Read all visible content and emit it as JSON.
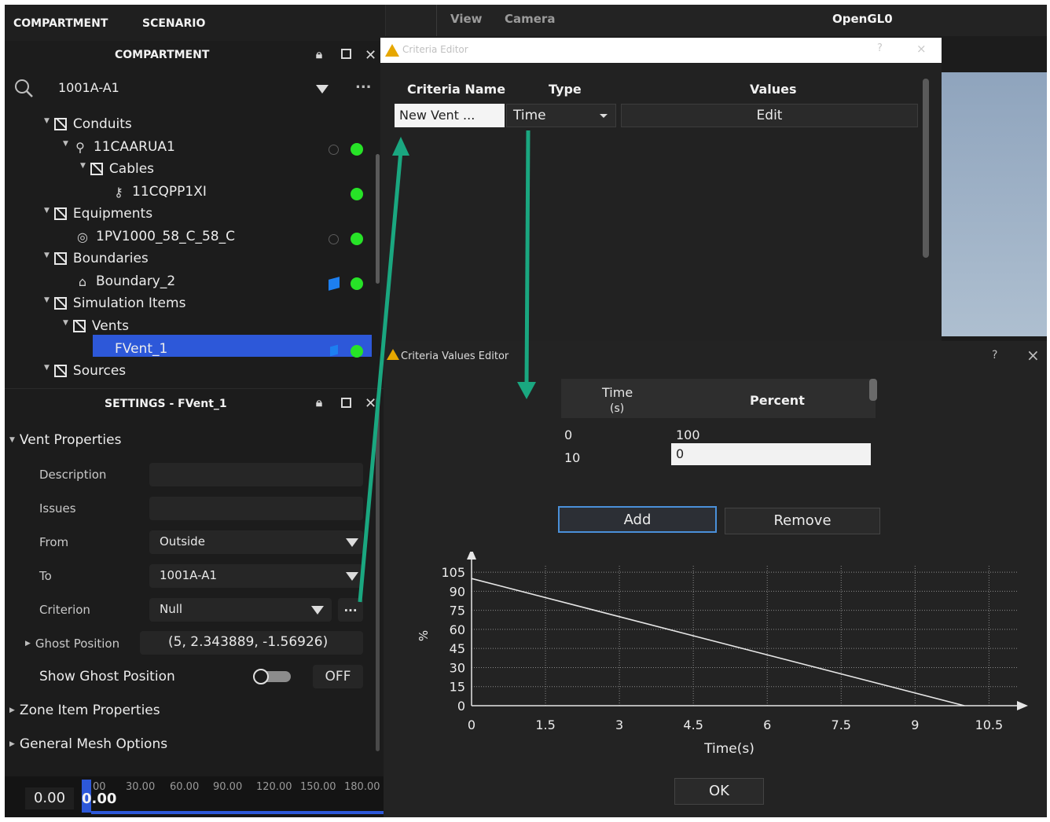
{
  "menu": {
    "compartment": "COMPARTMENT",
    "scenario": "SCENARIO"
  },
  "viewbar": {
    "view": "View",
    "camera": "Camera",
    "renderer": "OpenGL0"
  },
  "compartment_panel": {
    "title": "COMPARTMENT",
    "search_value": "1001A-A1",
    "more": "...",
    "tree": {
      "conduits": "Conduits",
      "conduit_item": "11CAARUA1",
      "cables": "Cables",
      "cable_item": "11CQPP1XI",
      "equipments": "Equipments",
      "equipment_item": "1PV1000_58_C_58_C",
      "boundaries": "Boundaries",
      "boundary_item": "Boundary_2",
      "simulation_items": "Simulation Items",
      "vents": "Vents",
      "vent_item": "FVent_1",
      "sources": "Sources"
    }
  },
  "settings_panel": {
    "title": "SETTINGS - FVent_1",
    "vent_properties": "Vent Properties",
    "description_label": "Description",
    "issues_label": "Issues",
    "from_label": "From",
    "from_value": "Outside",
    "to_label": "To",
    "to_value": "1001A-A1",
    "criterion_label": "Criterion",
    "criterion_value": "Null",
    "criterion_more": "...",
    "ghost_position_label": "Ghost Position",
    "ghost_position_value": "(5, 2.343889, -1.56926)",
    "show_ghost_label": "Show Ghost Position",
    "show_ghost_value": "OFF",
    "zone_item_properties": "Zone Item Properties",
    "general_mesh_options": "General Mesh Options"
  },
  "timeline": {
    "current": "0.00",
    "cursor": "0.00",
    "ticks": [
      "00",
      "30.00",
      "60.00",
      "90.00",
      "120.00",
      "150.00",
      "180.00"
    ]
  },
  "criteria_editor": {
    "title": "Criteria Editor",
    "help": "?",
    "close": "×",
    "col_name": "Criteria Name",
    "col_type": "Type",
    "col_values": "Values",
    "row_name": "New Vent ...",
    "row_type": "Time",
    "row_values": "Edit"
  },
  "values_editor": {
    "title": "Criteria Values Editor",
    "help": "?",
    "close": "×",
    "col_time": "Time",
    "col_time_unit": "(s)",
    "col_percent": "Percent",
    "rows": [
      {
        "time": "0",
        "percent": "100"
      },
      {
        "time": "10",
        "percent": "0"
      }
    ],
    "add": "Add",
    "remove": "Remove",
    "ok": "OK"
  },
  "chart_data": {
    "type": "line",
    "xlabel": "Time(s)",
    "ylabel": "%",
    "xlim": [
      0,
      11.1
    ],
    "ylim": [
      0,
      110
    ],
    "xticks": [
      "0",
      "1.5",
      "3",
      "4.5",
      "6",
      "7.5",
      "9",
      "10.5"
    ],
    "yticks": [
      "0",
      "15",
      "30",
      "45",
      "60",
      "75",
      "90",
      "105"
    ],
    "grid": true,
    "series": [
      {
        "x": [
          0,
          10
        ],
        "y": [
          100,
          0
        ],
        "color": "#e6e6e6"
      }
    ]
  },
  "colors": {
    "status_ok": "#27e327",
    "selection": "#2d58d9",
    "annotation_arrow": "#1aa780"
  }
}
